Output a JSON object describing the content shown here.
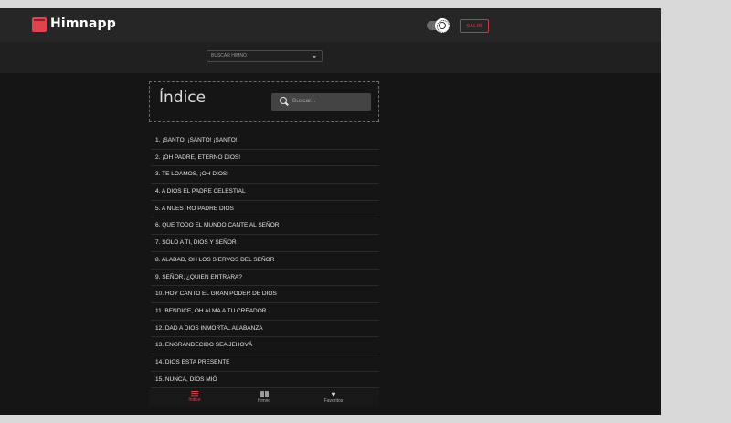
{
  "header": {
    "brand": "Himnapp",
    "logout_label": "SALIR",
    "theme_toggle": "sun"
  },
  "search_select": {
    "selected": "BUSCAR HIMNO"
  },
  "index": {
    "title": "Índice",
    "search_placeholder": "Buscar...",
    "hymns": [
      "1. ¡SANTO! ¡SANTO! ¡SANTO!",
      "2. ¡OH PADRE, ETERNO DIOS!",
      "3. TE LOAMOS, ¡OH DIOS!",
      "4. A DIOS EL PADRE CELESTIAL",
      "5. A NUESTRO PADRE DIOS",
      "6. QUE TODO EL MUNDO CANTE AL SEÑOR",
      "7. SOLO A TI, DIOS Y SEÑOR",
      "8. ALABAD, OH LOS SIERVOS DEL SEÑOR",
      "9. SEÑOR, ¿QUIEN ENTRARA?",
      "10. HOY CANTO EL GRAN PODER DE DIOS",
      "11. BENDICE, OH ALMA A TU CREADOR",
      "12. DAD A DIOS INMORTAL ALABANZA",
      "13. ENGRANDECIDO SEA JEHOVÁ",
      "14. DIOS ESTA PRESENTE",
      "15. NUNCA, DIOS MIÓ"
    ]
  },
  "bottom_nav": {
    "items": [
      {
        "label": "Índice",
        "icon": "list-icon",
        "active": true
      },
      {
        "label": "Himno",
        "icon": "book-icon",
        "active": false
      },
      {
        "label": "Favoritos",
        "icon": "heart-icon",
        "active": false
      }
    ]
  },
  "colors": {
    "accent": "#e0424f",
    "background": "#151515",
    "topbar": "#262626"
  }
}
